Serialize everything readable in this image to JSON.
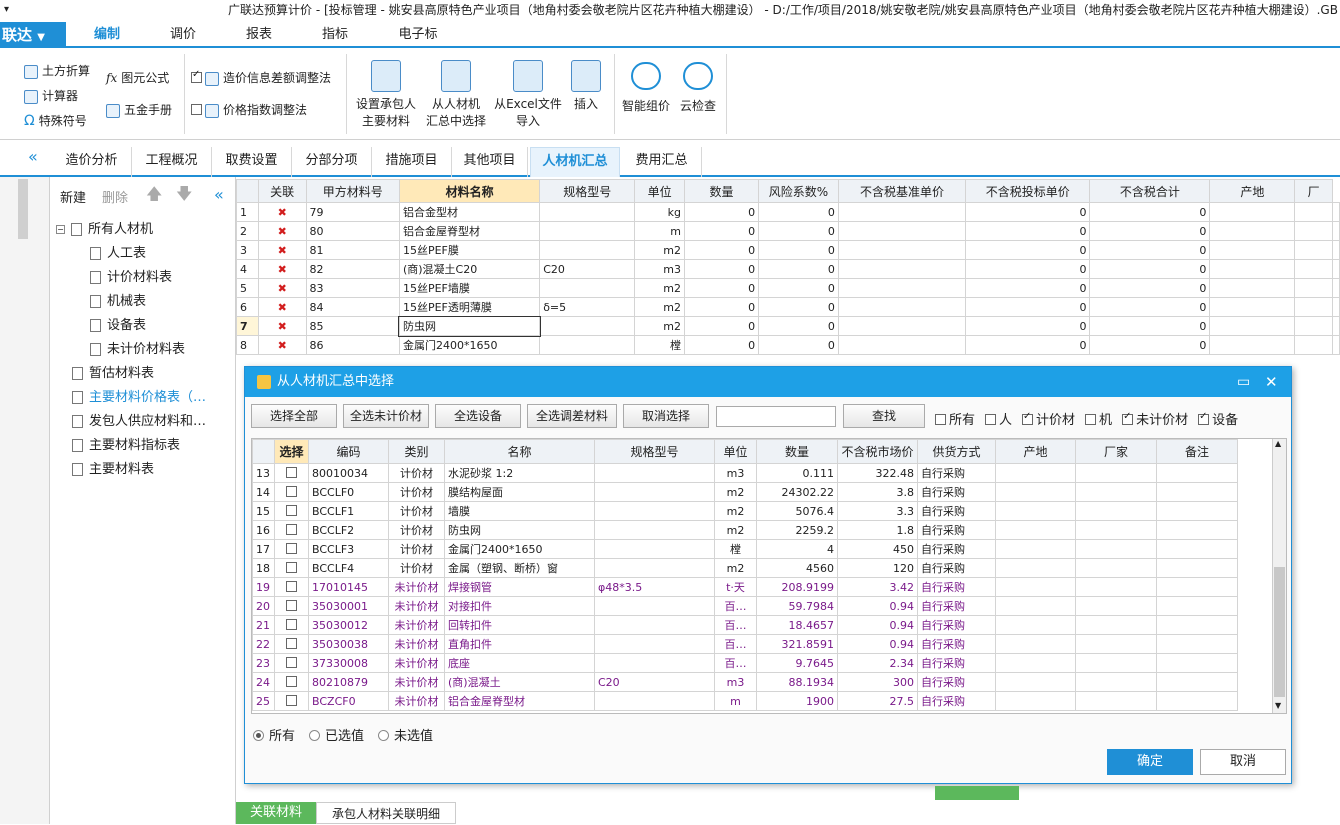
{
  "window": {
    "title": "广联达预算计价 - [投标管理 - 姚安县高原特色产业项目（地角村委会敬老院片区花卉种植大棚建设） - D:/工作/项目/2018/姚安敬老院/姚安县高原特色产业项目（地角村委会敬老院片区花卉种植大棚建设）.GB"
  },
  "app_menu": {
    "label": "联达"
  },
  "menu_tabs": [
    "编制",
    "调价",
    "报表",
    "指标",
    "电子标"
  ],
  "ribbon": {
    "left": [
      "土方折算",
      "计算器",
      "特殊符号"
    ],
    "mid": [
      "图元公式",
      "五金手册"
    ],
    "checks": [
      "造价信息差额调整法",
      "价格指数调整法"
    ],
    "big": [
      {
        "l1": "设置承包人",
        "l2": "主要材料"
      },
      {
        "l1": "从人材机",
        "l2": "汇总中选择"
      },
      {
        "l1": "从Excel文件",
        "l2": "导入"
      },
      {
        "l1": "插入",
        "l2": ""
      },
      {
        "l1": "智能组价",
        "l2": ""
      },
      {
        "l1": "云检查",
        "l2": ""
      }
    ]
  },
  "page_tabs": [
    "造价分析",
    "工程概况",
    "取费设置",
    "分部分项",
    "措施项目",
    "其他项目",
    "人材机汇总",
    "费用汇总"
  ],
  "tree": {
    "toolbar": {
      "new": "新建",
      "delete": "删除"
    },
    "items": [
      "所有人材机",
      "人工表",
      "计价材料表",
      "机械表",
      "设备表",
      "未计价材料表",
      "暂估材料表",
      "主要材料价格表（…",
      "发包人供应材料和…",
      "主要材料指标表",
      "主要材料表"
    ]
  },
  "grid": {
    "headers": [
      "",
      "关联",
      "甲方材料号",
      "材料名称",
      "规格型号",
      "单位",
      "数量",
      "风险系数%",
      "不含税基准单价",
      "不含税投标单价",
      "不含税合计",
      "产地",
      "厂"
    ],
    "rows": [
      [
        "1",
        "79",
        "铝合金型材",
        "",
        "kg",
        "0",
        "0",
        "",
        "0",
        "0"
      ],
      [
        "2",
        "80",
        "铝合金屋脊型材",
        "",
        "m",
        "0",
        "0",
        "",
        "0",
        "0"
      ],
      [
        "3",
        "81",
        "15丝PEF膜",
        "",
        "m2",
        "0",
        "0",
        "",
        "0",
        "0"
      ],
      [
        "4",
        "82",
        "(商)混凝土C20",
        "C20",
        "m3",
        "0",
        "0",
        "",
        "0",
        "0"
      ],
      [
        "5",
        "83",
        "15丝PEF墙膜",
        "",
        "m2",
        "0",
        "0",
        "",
        "0",
        "0"
      ],
      [
        "6",
        "84",
        "15丝PEF透明薄膜",
        "δ=5",
        "m2",
        "0",
        "0",
        "",
        "0",
        "0"
      ],
      [
        "7",
        "85",
        "防虫网",
        "",
        "m2",
        "0",
        "0",
        "",
        "0",
        "0"
      ],
      [
        "8",
        "86",
        "金属门2400*1650",
        "",
        "樘",
        "0",
        "0",
        "",
        "0",
        "0"
      ]
    ]
  },
  "dialog": {
    "title": "从人材机汇总中选择",
    "buttons": [
      "选择全部",
      "全选未计价材",
      "全选设备",
      "全选调差材料",
      "取消选择"
    ],
    "search_button": "查找",
    "search_value": "",
    "filters": [
      {
        "label": "所有",
        "checked": false
      },
      {
        "label": "人",
        "checked": false
      },
      {
        "label": "计价材",
        "checked": true
      },
      {
        "label": "机",
        "checked": false
      },
      {
        "label": "未计价材",
        "checked": true
      },
      {
        "label": "设备",
        "checked": true
      }
    ],
    "headers": [
      "",
      "选择",
      "编码",
      "类别",
      "名称",
      "规格型号",
      "单位",
      "数量",
      "不含税市场价",
      "供货方式",
      "产地",
      "厂家",
      "备注"
    ],
    "rows": [
      [
        "13",
        "80010034",
        "计价材",
        "水泥砂浆 1:2",
        "",
        "m3",
        "0.111",
        "322.48",
        "自行采购"
      ],
      [
        "14",
        "BCCLF0",
        "计价材",
        "膜结构屋面",
        "",
        "m2",
        "24302.22",
        "3.8",
        "自行采购"
      ],
      [
        "15",
        "BCCLF1",
        "计价材",
        "墙膜",
        "",
        "m2",
        "5076.4",
        "3.3",
        "自行采购"
      ],
      [
        "16",
        "BCCLF2",
        "计价材",
        "防虫网",
        "",
        "m2",
        "2259.2",
        "1.8",
        "自行采购"
      ],
      [
        "17",
        "BCCLF3",
        "计价材",
        "金属门2400*1650",
        "",
        "樘",
        "4",
        "450",
        "自行采购"
      ],
      [
        "18",
        "BCCLF4",
        "计价材",
        "金属（塑钢、断桥）窗",
        "",
        "m2",
        "4560",
        "120",
        "自行采购"
      ],
      [
        "19",
        "17010145",
        "未计价材",
        "焊接钢管",
        "φ48*3.5",
        "t·天",
        "208.9199",
        "3.42",
        "自行采购"
      ],
      [
        "20",
        "35030001",
        "未计价材",
        "对接扣件",
        "",
        "百…",
        "59.7984",
        "0.94",
        "自行采购"
      ],
      [
        "21",
        "35030012",
        "未计价材",
        "回转扣件",
        "",
        "百…",
        "18.4657",
        "0.94",
        "自行采购"
      ],
      [
        "22",
        "35030038",
        "未计价材",
        "直角扣件",
        "",
        "百…",
        "321.8591",
        "0.94",
        "自行采购"
      ],
      [
        "23",
        "37330008",
        "未计价材",
        "底座",
        "",
        "百…",
        "9.7645",
        "2.34",
        "自行采购"
      ],
      [
        "24",
        "80210879",
        "未计价材",
        "(商)混凝土",
        "C20",
        "m3",
        "88.1934",
        "300",
        "自行采购"
      ],
      [
        "25",
        "BCZCF0",
        "未计价材",
        "铝合金屋脊型材",
        "",
        "m",
        "1900",
        "27.5",
        "自行采购"
      ]
    ],
    "radios": [
      {
        "label": "所有",
        "checked": true
      },
      {
        "label": "已选值",
        "checked": false
      },
      {
        "label": "未选值",
        "checked": false
      }
    ],
    "ok": "确定",
    "cancel": "取消"
  },
  "bottom_tabs": [
    "关联材料",
    "承包人材料关联明细"
  ],
  "colors": {
    "accent": "#1f8fd6",
    "dialog_title": "#1ea0e6",
    "unpriced_text": "#7a1a8a",
    "delete_x": "#d21e1e",
    "header_highlight": "#ffe9b8"
  }
}
